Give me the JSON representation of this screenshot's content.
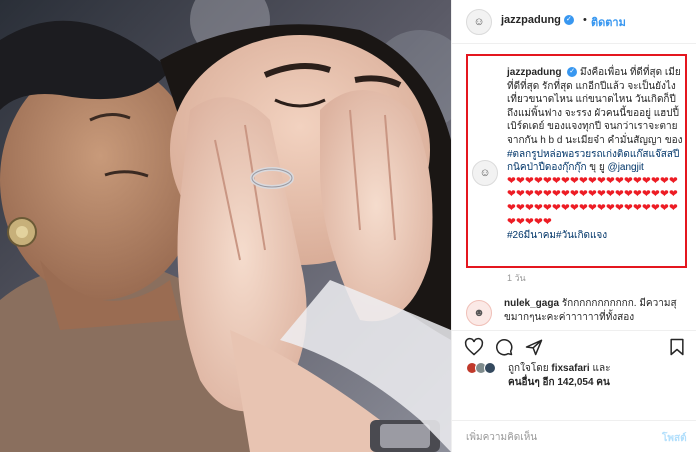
{
  "post": {
    "author": "jazzpadung",
    "separator": "•",
    "follow_label": "ติดตาม",
    "verified_icon": "verified-badge-icon"
  },
  "caption": {
    "author": "jazzpadung",
    "text": "มึงคือเพื่อน ที่ดีที่สุด เมียที่ดีที่สุด รักที่สุด แกอีกปีแล้ว จะเป็นยังไงเที่ยวขนาดไหน แก่ขนาดไหน วันเกิดก็ปีถึงแม่พิ้นฟาง จะรรง ผัวคนนี้ขออยู่ แฮปปี้เบิร์ดเดย์ ของแจงทุกปี จนกว่าเราจะตายจากกัน h b d นะเมียจ๋า คำมั่นสัญญา ของ",
    "hashtag1": "#ตลกรูปหล่อพอรวยรถเก่งติดแก๊สแจ๊สสปีกนิคป่าปืดองกุ๊กกุ๊ก",
    "mention_prefix": "ขุ ยู",
    "mention": "@jangjit",
    "hearts": "❤❤❤❤❤❤❤❤❤❤❤❤❤❤❤❤❤❤❤❤❤❤❤❤❤❤❤❤❤❤❤❤❤❤❤❤❤❤❤❤❤❤❤❤❤❤❤❤❤❤❤❤❤❤❤❤❤❤❤❤❤❤",
    "hashtag2": "#26มีนาคม#วันเกิดแจง",
    "time": "1 วัน"
  },
  "comment": {
    "author": "nulek_gaga",
    "text": "รักกกกกกกกกกก. มีความสุขมากๆนะคะค่าาาาาาที่ทั้งสอง"
  },
  "actions": {
    "like_icon": "heart-icon",
    "comment_icon": "comment-icon",
    "share_icon": "share-icon",
    "save_icon": "bookmark-icon"
  },
  "likes": {
    "prefix": "ถูกใจโดย",
    "user": "fixsafari",
    "connector": "และ",
    "others_prefix": "คนอื่นๆ อีก",
    "count": "142,054",
    "unit": "คน"
  },
  "posted_label": "",
  "comment_box": {
    "placeholder": "เพิ่มความคิดเห็น",
    "post_label": "โพสต์"
  },
  "colors": {
    "accent": "#3897f0",
    "highlight": "#e4161f",
    "heart": "#ed1c24"
  }
}
